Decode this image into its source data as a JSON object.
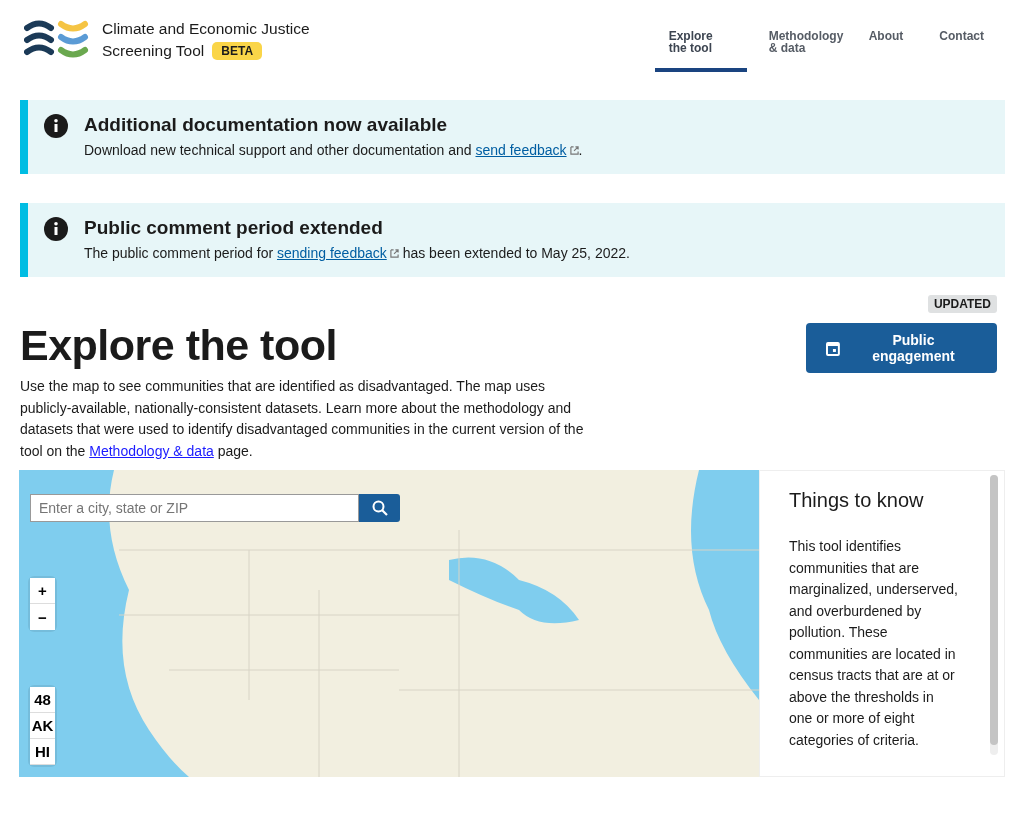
{
  "header": {
    "title_line_1": "Climate and Economic Justice",
    "title_line_2": "Screening Tool",
    "badge": "BETA",
    "nav": [
      {
        "label": "Explore the tool",
        "selected": true
      },
      {
        "label": "Methodology & data",
        "selected": false
      },
      {
        "label": "About",
        "selected": false
      },
      {
        "label": "Contact",
        "selected": false
      }
    ]
  },
  "alerts": [
    {
      "title": "Additional documentation now available",
      "text_before": "Download new technical support and other documentation and ",
      "link": "send feedback",
      "text_after": "."
    },
    {
      "title": "Public comment period extended",
      "text_before": "The public comment period for ",
      "link": "sending feedback",
      "text_after": " has been extended to May 25, 2022."
    }
  ],
  "page": {
    "heading": "Explore the tool",
    "tag": "UPDATED",
    "button": "Public engagement",
    "text_before": "Use the map to see communities that are identified as disadvantaged. The map uses publicly-available, nationally-consistent datasets. Learn more about the methodology and datasets that were used to identify disadvantaged communities in the current version of the tool on the ",
    "link": "Methodology & data",
    "text_after": " page."
  },
  "map": {
    "search": {
      "placeholder": "Enter a city, state or ZIP"
    },
    "zoom_in": "+",
    "zoom_out": "−",
    "territories": [
      "48",
      "AK",
      "HI"
    ]
  },
  "info_panel": {
    "title": "Things to know",
    "text": "This tool identifies communities that are marginalized, underserved, and overburdened by pollution. These communities are located in census tracts that are at or above the thresholds in one or more of eight categories of criteria."
  }
}
